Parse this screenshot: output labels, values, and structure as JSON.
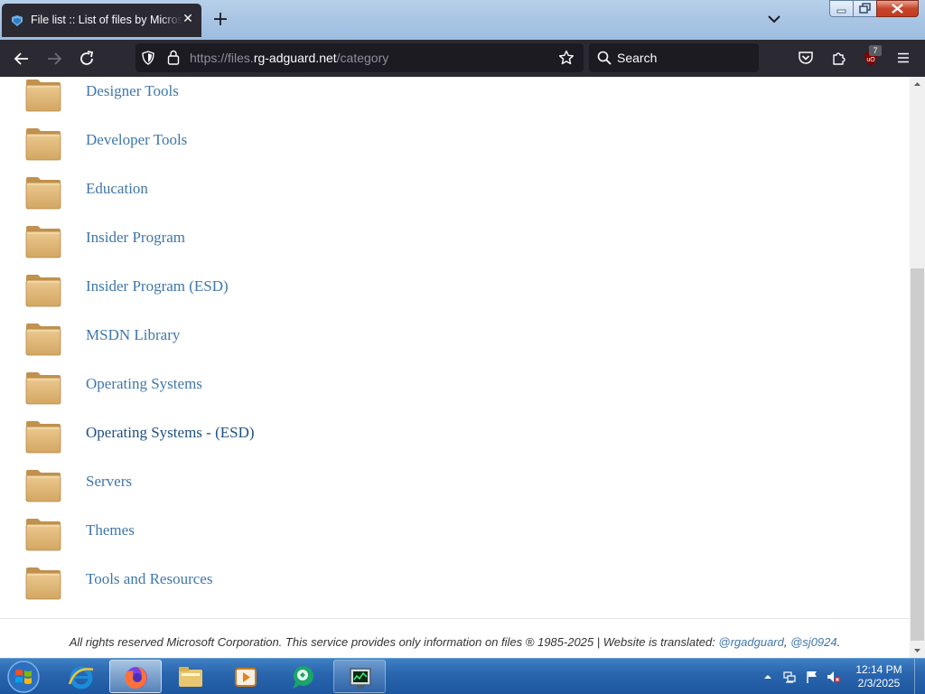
{
  "browser": {
    "tab": {
      "title": "File list :: List of files by Microsoft",
      "favicon": "rg-adguard-icon"
    },
    "address_bar": {
      "url_prefix": "https://files.",
      "url_host": "rg-adguard.net",
      "url_path": "/category"
    },
    "search": {
      "placeholder": "Search"
    },
    "extensions": {
      "ublock_badge": "7"
    }
  },
  "page": {
    "categories": [
      {
        "label": "Designer Tools"
      },
      {
        "label": "Developer Tools"
      },
      {
        "label": "Education"
      },
      {
        "label": "Insider Program"
      },
      {
        "label": "Insider Program (ESD)"
      },
      {
        "label": "MSDN Library"
      },
      {
        "label": "Operating Systems"
      },
      {
        "label": "Operating Systems - (ESD)"
      },
      {
        "label": "Servers"
      },
      {
        "label": "Themes"
      },
      {
        "label": "Tools and Resources"
      }
    ],
    "footer": {
      "text": "All rights reserved Microsoft Corporation. This service provides only information on files ® 1985-2025 | Website is translated: ",
      "link1": "@rgadguard",
      "separator": ", ",
      "link2": "@sj0924",
      "end": "."
    }
  },
  "taskbar": {
    "apps": [
      "firefox-icon",
      "internet-explorer-icon",
      "file-explorer-icon",
      "media-player-icon",
      "messenger-icon",
      "task-manager-icon"
    ],
    "clock": {
      "time": "12:14 PM",
      "date": "2/3/2025"
    }
  },
  "colors": {
    "link": "#3e76ab",
    "toolbar": "#2b2a33",
    "urlbar": "#1c1b22",
    "folder": "#e2b97a"
  }
}
